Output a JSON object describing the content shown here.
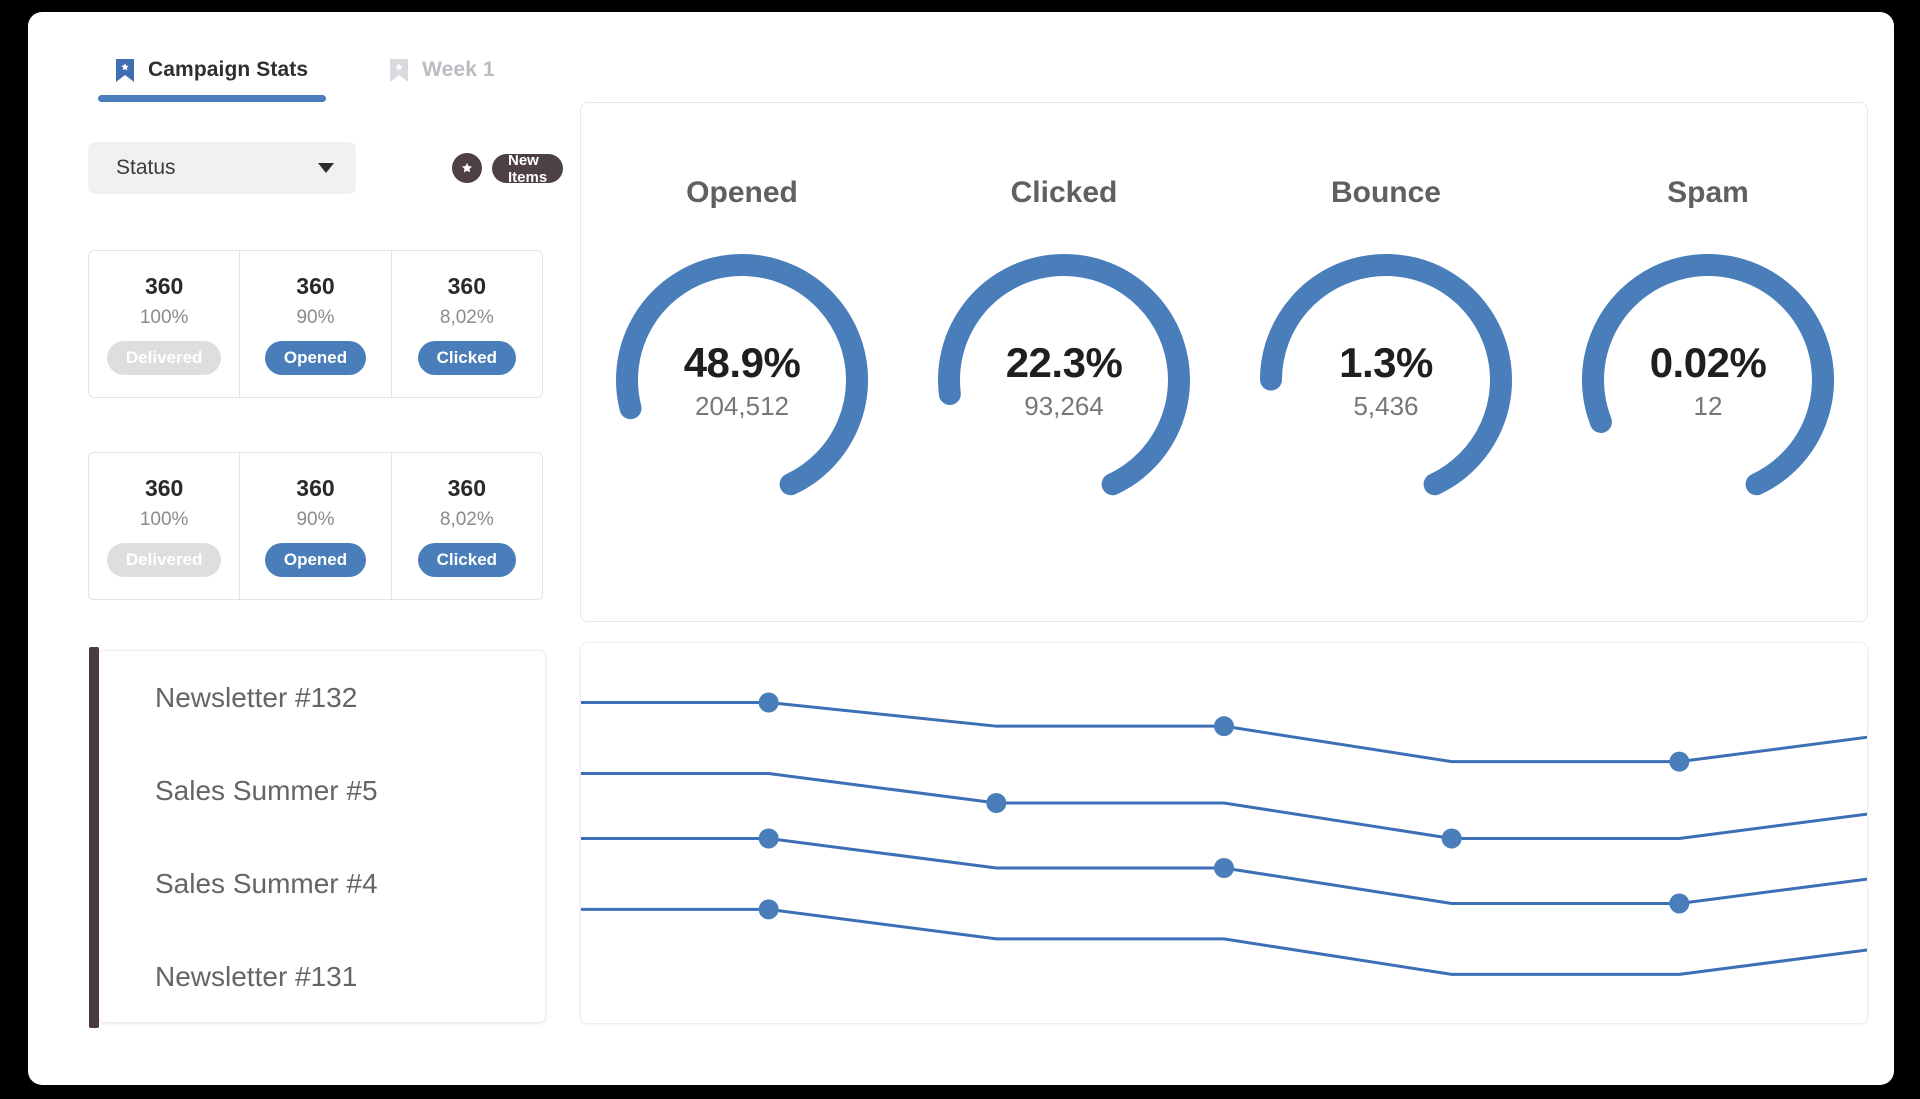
{
  "tabs": [
    {
      "label": "Campaign Stats",
      "icon": "bookmark-icon",
      "active": true
    },
    {
      "label": "Week 1",
      "icon": "bookmark-icon",
      "active": false
    }
  ],
  "filters": {
    "status_select": {
      "value": "Status",
      "icon": "chevron-down-icon"
    },
    "star_badge_icon": "star-icon",
    "new_items_label": "New Items"
  },
  "stat_groups": [
    {
      "cells": [
        {
          "count": "360",
          "percent": "100%",
          "pill": "Delivered",
          "pill_style": "muted"
        },
        {
          "count": "360",
          "percent": "90%",
          "pill": "Opened",
          "pill_style": "blue"
        },
        {
          "count": "360",
          "percent": "8,02%",
          "pill": "Clicked",
          "pill_style": "blue"
        }
      ]
    },
    {
      "cells": [
        {
          "count": "360",
          "percent": "100%",
          "pill": "Delivered",
          "pill_style": "muted"
        },
        {
          "count": "360",
          "percent": "90%",
          "pill": "Opened",
          "pill_style": "blue"
        },
        {
          "count": "360",
          "percent": "8,02%",
          "pill": "Clicked",
          "pill_style": "blue"
        }
      ]
    }
  ],
  "campaigns": [
    {
      "name": "Newsletter #132"
    },
    {
      "name": "Sales Summer #5"
    },
    {
      "name": "Sales Summer #4"
    },
    {
      "name": "Newsletter #131"
    }
  ],
  "colors": {
    "accent_blue": "#4a7ebb",
    "track_gray": "#e8edf4",
    "dark": "#4e4145",
    "muted_pill": "#dedede"
  },
  "chart_data": [
    {
      "type": "pie",
      "title": "Opened",
      "percent_label": "48.9%",
      "value_label": "204,512",
      "value": 204512,
      "percent": 48.9,
      "arc_fraction": 0.72,
      "ring_color": "#4a7ebb",
      "track_color": "#e8edf4"
    },
    {
      "type": "pie",
      "title": "Clicked",
      "percent_label": "22.3%",
      "value_label": "93,264",
      "value": 93264,
      "percent": 22.3,
      "arc_fraction": 0.7,
      "ring_color": "#4a7ebb",
      "track_color": "#e8edf4"
    },
    {
      "type": "pie",
      "title": "Bounce",
      "percent_label": "1.3%",
      "value_label": "5,436",
      "value": 5436,
      "percent": 1.3,
      "arc_fraction": 0.68,
      "ring_color": "#4a7ebb",
      "track_color": "#e8edf4"
    },
    {
      "type": "pie",
      "title": "Spam",
      "percent_label": "0.02%",
      "value_label": "12",
      "value": 12,
      "percent": 0.02,
      "arc_fraction": 0.74,
      "ring_color": "#4a7ebb",
      "track_color": "#e8edf4"
    },
    {
      "type": "line",
      "title": "",
      "xlabel": "",
      "ylabel": "",
      "grid": false,
      "legend": "none",
      "x": [
        0,
        1,
        2,
        3,
        4,
        5,
        6
      ],
      "series": [
        {
          "name": "Newsletter #132",
          "values": [
            100,
            100,
            92,
            92,
            80,
            80,
            90
          ],
          "marker_points": [
            1,
            3,
            5
          ]
        },
        {
          "name": "Sales Summer #5",
          "values": [
            76,
            76,
            66,
            66,
            54,
            54,
            64
          ],
          "marker_points": [
            0,
            2,
            4
          ]
        },
        {
          "name": "Sales Summer #4",
          "values": [
            54,
            54,
            44,
            44,
            32,
            32,
            42
          ],
          "marker_points": [
            1,
            3,
            5
          ]
        },
        {
          "name": "Newsletter #131",
          "values": [
            30,
            30,
            20,
            20,
            8,
            8,
            18
          ],
          "marker_points": [
            1,
            6
          ]
        }
      ],
      "line_color": "#3c6fb5",
      "marker_color": "#4a7ebb"
    }
  ]
}
